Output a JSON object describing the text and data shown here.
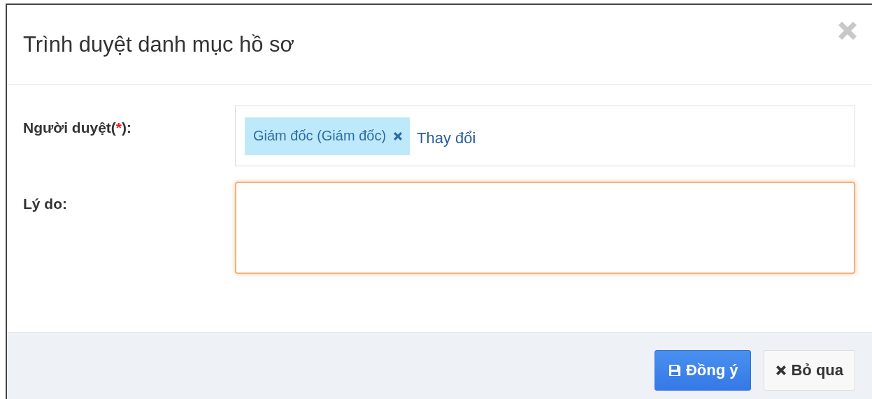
{
  "dialog": {
    "title": "Trình duyệt danh mục hồ sơ"
  },
  "fields": [
    {
      "kind": "tags",
      "label": "Người duyệt(",
      "required_mark": "*",
      "label_end": "):",
      "tags": [
        "Giám đốc (Giám đốc)"
      ],
      "action": "Thay đổi"
    },
    {
      "kind": "textarea",
      "label": "Lý do:",
      "focused": true
    }
  ],
  "buttons": [
    {
      "kind": "primary",
      "label": "Đồng ý"
    },
    {
      "kind": "cancel",
      "label": "Bỏ qua"
    }
  ]
}
